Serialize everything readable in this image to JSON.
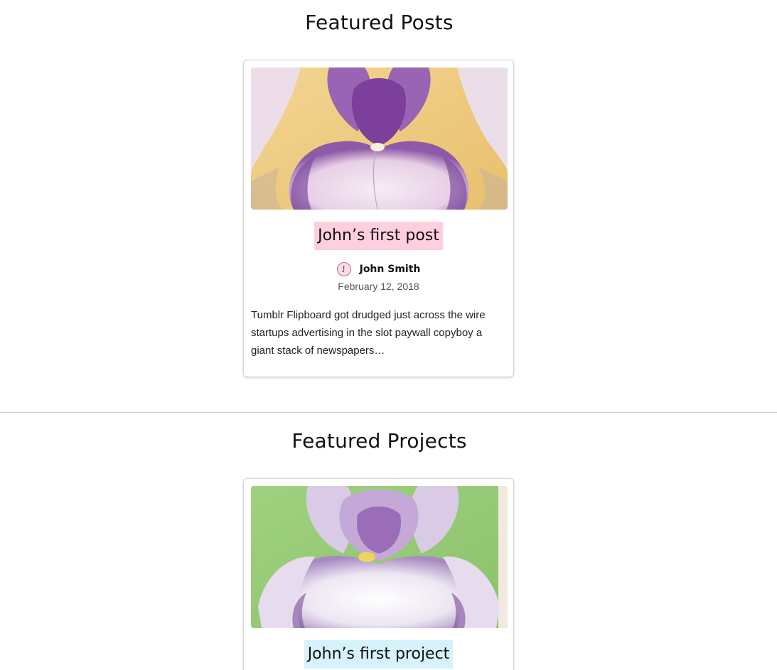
{
  "posts_section": {
    "title": "Featured Posts",
    "card": {
      "image_alt": "Purple and white iris flower",
      "title": "John’s first post",
      "author_name": "John Smith",
      "date": "February 12, 2018",
      "excerpt": "Tumblr Flipboard got drudged just across the wire startups advertising in the slot paywall copyboy a giant stack of newspapers…",
      "highlight_color": "#ffcfde"
    }
  },
  "projects_section": {
    "title": "Featured Projects",
    "card": {
      "image_alt": "Pale lavender iris flower on green background",
      "title": "John’s first project",
      "highlight_color": "#d6f2fb"
    }
  },
  "icons": {
    "avatar": "author-avatar-icon"
  }
}
